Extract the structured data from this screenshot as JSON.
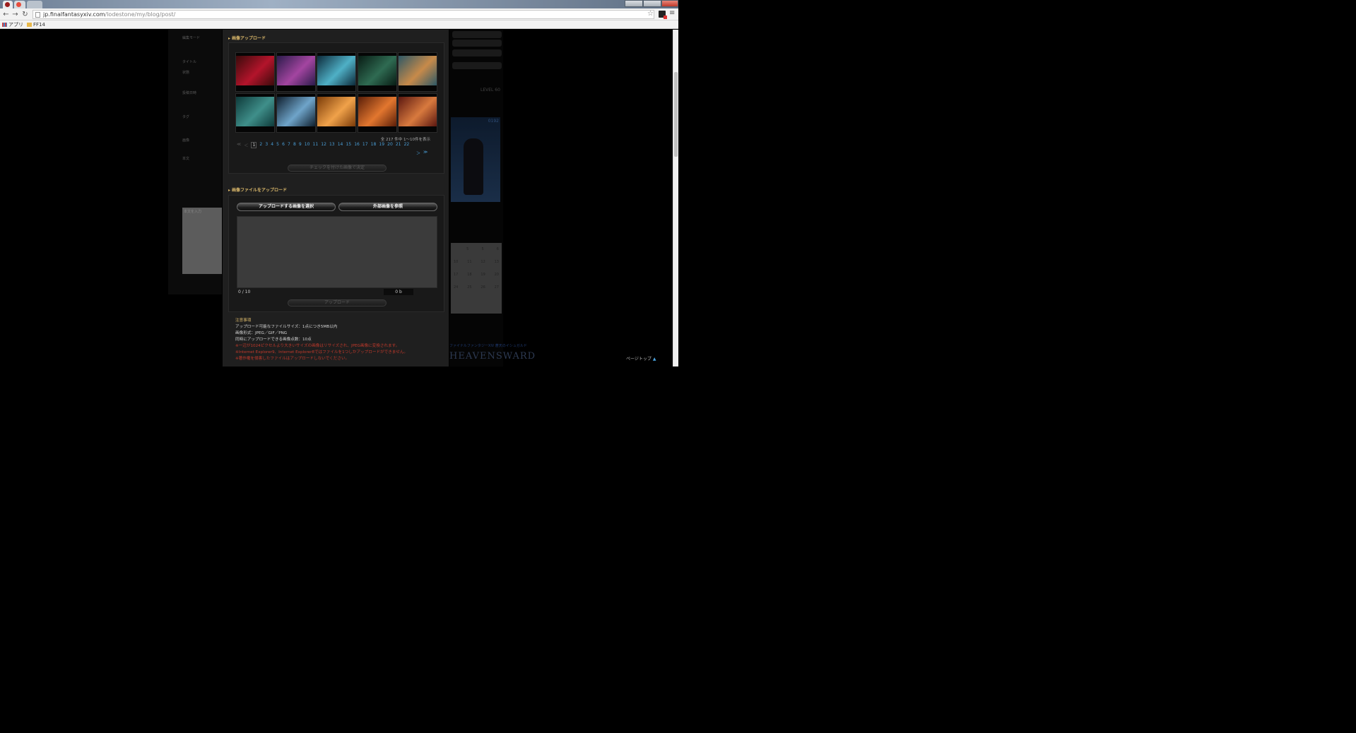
{
  "browser": {
    "address": {
      "host": "jp.finalfantasyxiv.com",
      "path": "/lodestone/my/blog/post/"
    },
    "bookmarks": [
      {
        "label": "アプリ",
        "icon": "apps-grid-icon"
      },
      {
        "label": "FF14",
        "icon": "folder-icon"
      }
    ]
  },
  "background_form": {
    "labels": [
      {
        "text": "編集モード",
        "red": false
      },
      {
        "text": "タイトル",
        "red": false
      },
      {
        "text": "状態",
        "red": false
      },
      {
        "text": "投稿日時",
        "red": false
      },
      {
        "text": "タグ",
        "red": false
      },
      {
        "text": "画像",
        "red": false
      },
      {
        "text": "本文",
        "red": false
      }
    ],
    "textarea_placeholder": "本文を入力"
  },
  "sidebar": {
    "level_text": "LEVEL 60",
    "char_number": "0192",
    "brand": "HEAVENSWARD",
    "brand_sub": "ファイナルファンタジーXIV 蒼天のイシュガルド",
    "calendar_rows": [
      [
        "",
        "5",
        "5",
        "6"
      ],
      [
        "10",
        "11",
        "12",
        "13"
      ],
      [
        "17",
        "18",
        "19",
        "20"
      ],
      [
        "24",
        "25",
        "26",
        "27"
      ]
    ]
  },
  "page_top_label": "ページトップ",
  "modal": {
    "image_upload_title": "画像アップロード",
    "images": [
      {
        "name": "thumb-1",
        "colors": [
          "#3a0b0b",
          "#b3142b"
        ]
      },
      {
        "name": "thumb-2",
        "colors": [
          "#2b1b4b",
          "#a345a0"
        ]
      },
      {
        "name": "thumb-3",
        "colors": [
          "#0d2a3a",
          "#4fb0c6"
        ]
      },
      {
        "name": "thumb-4",
        "colors": [
          "#081c14",
          "#2f6b52"
        ]
      },
      {
        "name": "thumb-5",
        "colors": [
          "#2d5866",
          "#c78a4a"
        ]
      },
      {
        "name": "thumb-6",
        "colors": [
          "#0e3a3a",
          "#3f8f8a"
        ]
      },
      {
        "name": "thumb-7",
        "colors": [
          "#0f1f2e",
          "#6fa4c9"
        ]
      },
      {
        "name": "thumb-8",
        "colors": [
          "#7a3a08",
          "#f0a24a"
        ]
      },
      {
        "name": "thumb-9",
        "colors": [
          "#5a1e08",
          "#e2772f"
        ]
      },
      {
        "name": "thumb-10",
        "colors": [
          "#5b1710",
          "#d87a3e"
        ]
      }
    ],
    "count_text": "全 217 件中 1〜10件を表示",
    "pager": {
      "first": "≪",
      "prev": "＜",
      "pages": [
        "1",
        "2",
        "3",
        "4",
        "5",
        "6",
        "7",
        "8",
        "9",
        "10",
        "11",
        "12",
        "13",
        "14",
        "15",
        "16",
        "17",
        "18",
        "19",
        "20",
        "21",
        "22"
      ],
      "current": "1",
      "next": "＞",
      "last": "≫"
    },
    "decide_label": "チェックを付けた画像で決定",
    "file_upload_title": "画像ファイルをアップロード",
    "select_label": "アップロードする画像を選択",
    "external_label": "外部画像を参照",
    "file_count": "0 / 10",
    "file_size": "0 b",
    "upload_label": "アップロード",
    "notes": {
      "title": "注意事項",
      "lines": [
        {
          "text": "アップロード可能なファイルサイズ：1点につき5MB以内",
          "red": false
        },
        {
          "text": "画像形式：JPEG／GIF／PNG",
          "red": false
        },
        {
          "text": "同時にアップロードできる画像点数：10点",
          "red": false
        },
        {
          "text": "※一辺が1024ピクセルより大きいサイズの画像はリサイズされ、JPEG画像に変換されます。",
          "red": true
        },
        {
          "text": "※Internet Explorer9、Internet Explorer8ではファイルを1つしかアップロードができません。",
          "red": true
        },
        {
          "text": "※著作権を侵害したファイルはアップロードしないでください。",
          "red": true
        }
      ]
    }
  },
  "colors": {
    "accent_gold": "#d9b76a",
    "link_blue": "#4a9fd8",
    "warning_red": "#c0392b"
  }
}
